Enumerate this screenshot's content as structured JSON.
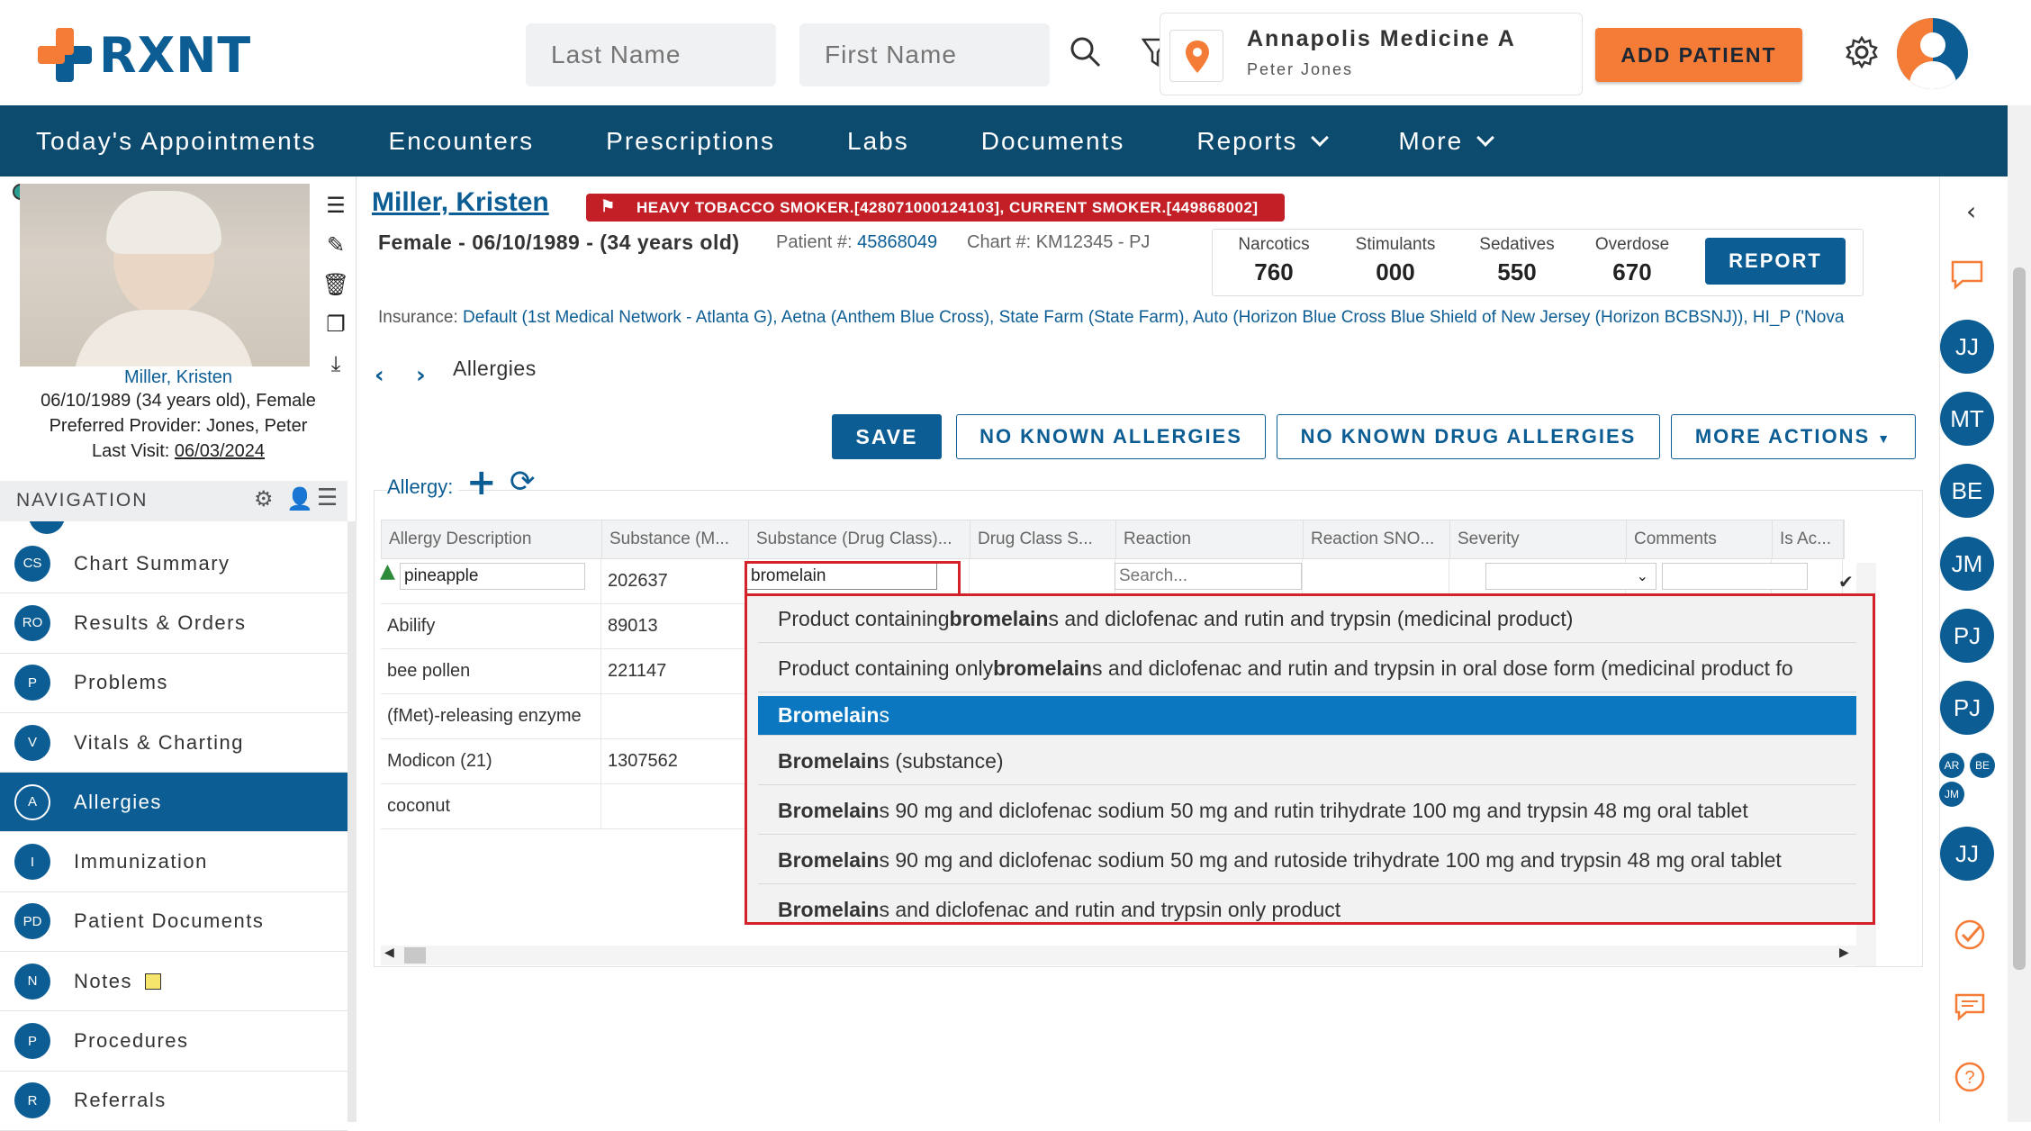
{
  "header": {
    "logo_text": "RXNT",
    "last_name_placeholder": "Last Name",
    "first_name_placeholder": "First Name",
    "location_name": "Annapolis Medicine A",
    "location_user": "Peter Jones",
    "add_patient_label": "ADD PATIENT",
    "accent_color": "#f47c36",
    "brand_color": "#0c5d94"
  },
  "navbar": {
    "items": [
      {
        "label": "Today's Appointments"
      },
      {
        "label": "Encounters"
      },
      {
        "label": "Prescriptions"
      },
      {
        "label": "Labs"
      },
      {
        "label": "Documents"
      },
      {
        "label": "Reports"
      },
      {
        "label": "More"
      }
    ]
  },
  "patient_card": {
    "name_link": "Miller, Kristen",
    "dob_line": "06/10/1989 (34 years old), Female",
    "provider_line": "Preferred Provider:  Jones, Peter",
    "last_visit_label": "Last Visit: ",
    "last_visit_value": "06/03/2024"
  },
  "navigation": {
    "title": "NAVIGATION",
    "items": [
      {
        "badge": "CS",
        "label": "Chart Summary"
      },
      {
        "badge": "RO",
        "label": "Results & Orders"
      },
      {
        "badge": "P",
        "label": "Problems"
      },
      {
        "badge": "V",
        "label": "Vitals & Charting"
      },
      {
        "badge": "A",
        "label": "Allergies"
      },
      {
        "badge": "I",
        "label": "Immunization"
      },
      {
        "badge": "PD",
        "label": "Patient Documents"
      },
      {
        "badge": "N",
        "label": "Notes"
      },
      {
        "badge": "P",
        "label": "Procedures"
      },
      {
        "badge": "R",
        "label": "Referrals"
      }
    ]
  },
  "patient": {
    "name": "Miller, Kristen",
    "flag": "HEAVY TOBACCO SMOKER.[428071000124103], CURRENT SMOKER.[449868002]",
    "demographics": "Female - 06/10/1989 - (34 years old)",
    "patient_num_label": "Patient #:",
    "patient_num": "45868049",
    "chart_num": "Chart #: KM12345 - PJ",
    "insurance_label": "Insurance:",
    "insurance_value": "Default (1st Medical Network - Atlanta G), Aetna (Anthem Blue Cross), State Farm (State Farm), Auto (Horizon Blue Cross Blue Shield of New Jersey (Horizon BCBSNJ)), HI_P ('Nova"
  },
  "pdmp": {
    "narcotics_label": "Narcotics",
    "narcotics": "760",
    "stimulants_label": "Stimulants",
    "stimulants": "000",
    "sedatives_label": "Sedatives",
    "sedatives": "550",
    "overdose_label": "Overdose",
    "overdose": "670",
    "report_label": "REPORT"
  },
  "page": {
    "breadcrumb_title": "Allergies",
    "save_label": "SAVE",
    "nka_label": "NO KNOWN ALLERGIES",
    "nkda_label": "NO KNOWN DRUG ALLERGIES",
    "more_actions_label": "MORE ACTIONS",
    "allergy_label": "Allergy:"
  },
  "grid": {
    "headers": [
      "Allergy Description",
      "Substance (M...",
      "Substance (Drug Class)...",
      "Drug Class S...",
      "Reaction",
      "Reaction SNO...",
      "Severity",
      "Comments",
      "Is Ac..."
    ],
    "edit_row": {
      "description": "pineapple",
      "substance_code": "202637",
      "drug_class_input": "bromelain",
      "reaction_placeholder": "Search..."
    },
    "rows": [
      {
        "description": "Abilify",
        "code": "89013"
      },
      {
        "description": "bee pollen",
        "code": "221147"
      },
      {
        "description": "(fMet)-releasing enzyme",
        "code": ""
      },
      {
        "description": "Modicon (21)",
        "code": "1307562"
      },
      {
        "description": "coconut",
        "code": ""
      }
    ]
  },
  "dropdown": {
    "items": [
      {
        "pre": "Product containing ",
        "match": "bromelain",
        "post": "s and diclofenac and rutin and trypsin (medicinal product)",
        "selected": false
      },
      {
        "pre": "Product containing only ",
        "match": "bromelain",
        "post": "s and diclofenac and rutin and trypsin in oral dose form (medicinal product fo",
        "selected": false
      },
      {
        "pre": "",
        "match": "Bromelain",
        "post": "s",
        "selected": true
      },
      {
        "pre": "",
        "match": "Bromelain",
        "post": "s (substance)",
        "selected": false
      },
      {
        "pre": "",
        "match": "Bromelain",
        "post": "s 90 mg and diclofenac sodium 50 mg and rutin trihydrate 100 mg and trypsin 48 mg oral tablet",
        "selected": false
      },
      {
        "pre": "",
        "match": "Bromelain",
        "post": "s 90 mg and diclofenac sodium 50 mg and rutoside trihydrate 100 mg and trypsin 48 mg oral tablet",
        "selected": false
      },
      {
        "pre": "",
        "match": "Bromelain",
        "post": "s and diclofenac and rutin and trypsin only product",
        "selected": false
      }
    ]
  },
  "rightrail": {
    "avatars": [
      "JJ",
      "MT",
      "BE",
      "JM",
      "PJ",
      "PJ"
    ],
    "mini": [
      "AR",
      "BE",
      "JM"
    ],
    "last_avatar": "JJ"
  }
}
